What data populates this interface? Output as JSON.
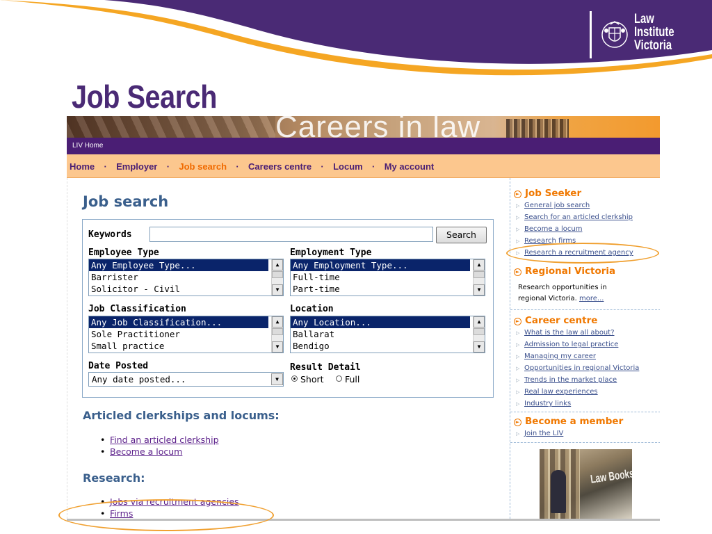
{
  "slide": {
    "title": "Job Search",
    "logo": {
      "line1": "Law",
      "line2": "Institute",
      "line3": "Victoria"
    },
    "colors": {
      "purple": "#4a2a75",
      "orange": "#f5a623",
      "white": "#ffffff"
    }
  },
  "site": {
    "banner_title": "Careers in law",
    "utility_link": "LIV Home",
    "nav": [
      {
        "label": "Home"
      },
      {
        "label": "Employer"
      },
      {
        "label": "Job search",
        "active": true
      },
      {
        "label": "Careers centre"
      },
      {
        "label": "Locum"
      },
      {
        "label": "My account"
      }
    ],
    "nav_separator": "·"
  },
  "main": {
    "heading": "Job search",
    "form": {
      "keywords_label": "Keywords",
      "keywords_value": "",
      "search_button": "Search",
      "employee_type": {
        "label": "Employee Type",
        "options": [
          "Any Employee Type...",
          "Barrister",
          "Solicitor - Civil"
        ],
        "selected": "Any Employee Type..."
      },
      "employment_type": {
        "label": "Employment Type",
        "options": [
          "Any Employment Type...",
          "Full-time",
          "Part-time"
        ],
        "selected": "Any Employment Type..."
      },
      "job_classification": {
        "label": "Job Classification",
        "options": [
          "Any Job Classification...",
          "Sole Practitioner",
          "Small practice"
        ],
        "selected": "Any Job Classification..."
      },
      "location": {
        "label": "Location",
        "options": [
          "Any Location...",
          "Ballarat",
          "Bendigo"
        ],
        "selected": "Any Location..."
      },
      "date_posted": {
        "label": "Date Posted",
        "value": "Any date posted..."
      },
      "result_detail": {
        "label": "Result Detail",
        "options": [
          "Short",
          "Full"
        ],
        "selected": "Short"
      }
    },
    "articled": {
      "heading": "Articled clerkships and locums:",
      "links": [
        "Find an articled clerkship",
        "Become a locum"
      ]
    },
    "research": {
      "heading": "Research:",
      "links": [
        "Jobs via recruitment agencies",
        "Firms"
      ]
    }
  },
  "sidebar": {
    "job_seeker": {
      "heading": "Job Seeker",
      "links": [
        "General job search",
        "Search for an articled clerkship",
        "Become a locum",
        "Research firms",
        "Research a recruitment agency"
      ]
    },
    "regional": {
      "heading": "Regional Victoria",
      "text": "Research opportunities in regional Victoria.",
      "more": "more..."
    },
    "career_centre": {
      "heading": "Career centre",
      "links": [
        "What is the law all about?",
        "Admission to legal practice",
        "Managing my career",
        "Opportunities in regional Victoria",
        "Trends in the market place",
        "Real law experiences",
        "Industry links"
      ]
    },
    "member": {
      "heading": "Become a member",
      "links": [
        "Join the LIV"
      ]
    },
    "image_sign": "Law Booksh"
  }
}
